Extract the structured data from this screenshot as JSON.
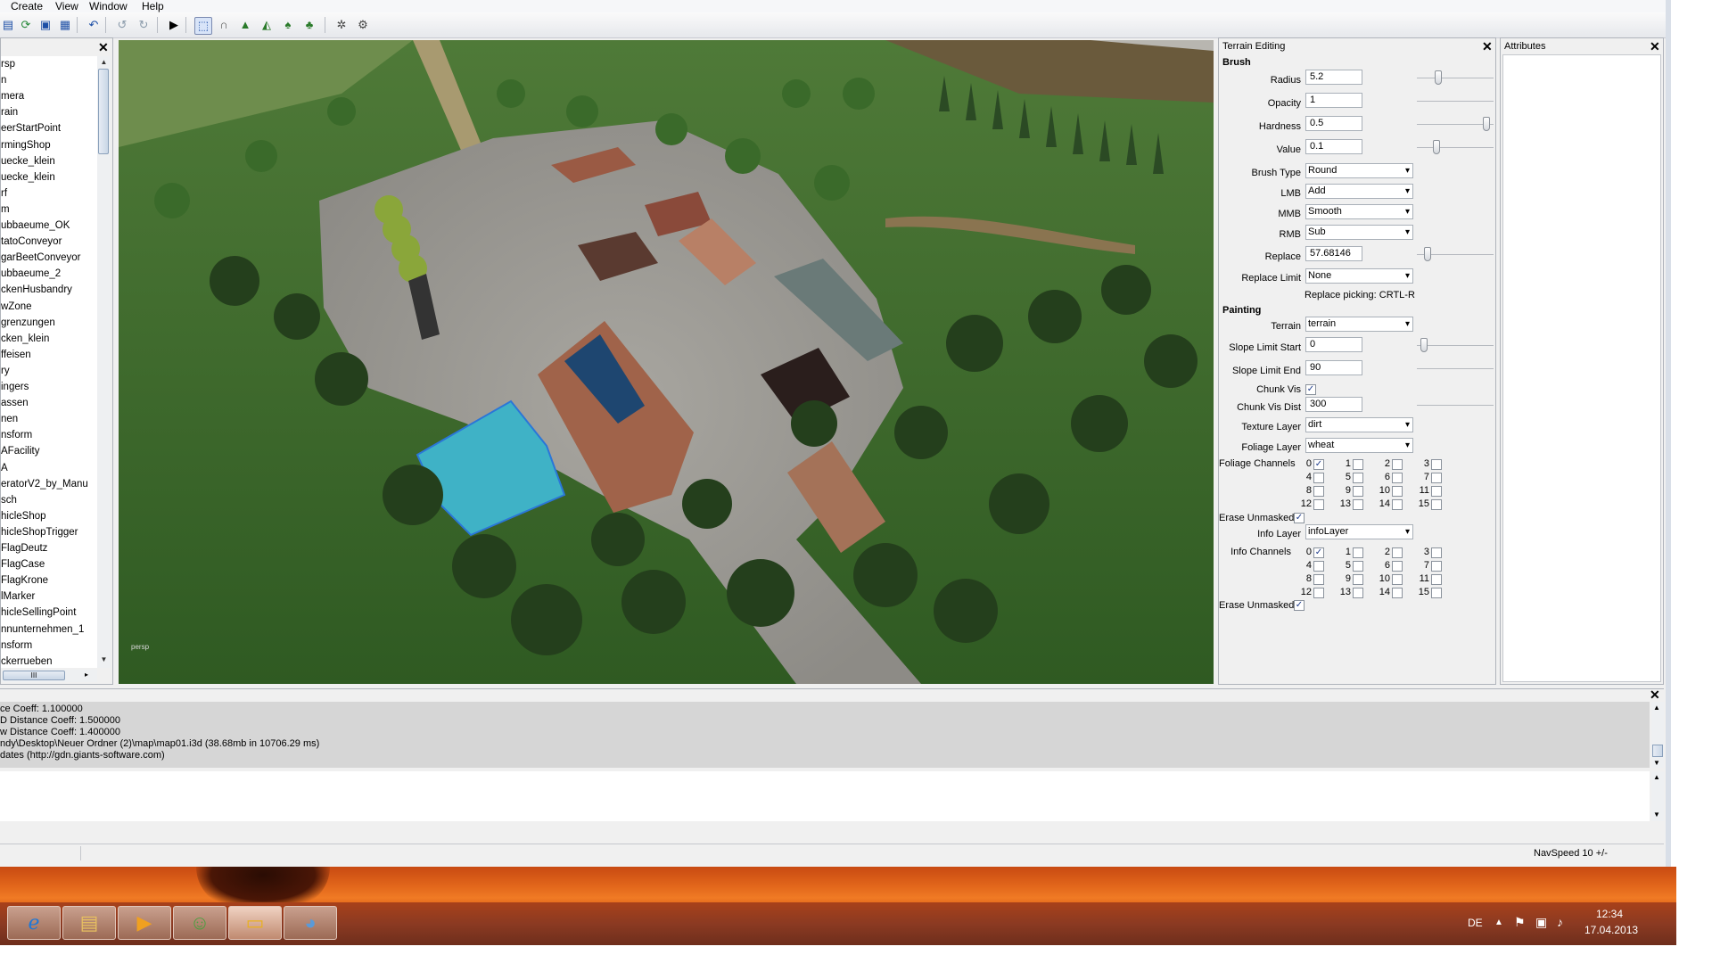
{
  "menu": [
    "Create",
    "View",
    "Window",
    "Help"
  ],
  "toolbar_icons": [
    "new-icon",
    "open-icon",
    "save-icon",
    "save-all-icon",
    "import-icon",
    "undo-icon",
    "redo-icon",
    "play-icon",
    "select-mode-icon",
    "move-mode-icon",
    "terrain-sculpt-icon",
    "terrain-paint-icon",
    "foliage-paint-icon",
    "info-paint-icon",
    "settings-icon",
    "settings-alt-icon"
  ],
  "scene_tree": {
    "items": [
      "rsp",
      "n",
      "mera",
      "rain",
      "eerStartPoint",
      "rmingShop",
      "uecke_klein",
      "uecke_klein",
      "rf",
      "m",
      "ubbaeume_OK",
      "tatoConveyor",
      "garBeetConveyor",
      "ubbaeume_2",
      "ckenHusbandry",
      "wZone",
      "grenzungen",
      "cken_klein",
      "ffeisen",
      "ry",
      "ingers",
      "assen",
      "nen",
      "nsform",
      "AFacility",
      "A",
      "eratorV2_by_Manu",
      "sch",
      "hicleShop",
      "hicleShopTrigger",
      "FlagDeutz",
      "FlagCase",
      "FlagKrone",
      "lMarker",
      "hicleSellingPoint",
      "nnunternehmen_1",
      "nsform",
      "ckerrueben"
    ],
    "hscroll_label": "III"
  },
  "viewport": {
    "label": "persp"
  },
  "terrain_editing": {
    "title": "Terrain Editing",
    "brush_section": "Brush",
    "radius_label": "Radius",
    "radius_value": "5.2",
    "radius_level": 0.25,
    "opacity_label": "Opacity",
    "opacity_value": "1",
    "hardness_label": "Hardness",
    "hardness_value": "0.5",
    "hardness_level": 0.95,
    "value_label": "Value",
    "value_value": "0.1",
    "value_level": 0.23,
    "brush_type_label": "Brush Type",
    "brush_type_value": "Round",
    "lmb_label": "LMB",
    "lmb_value": "Add",
    "mmb_label": "MMB",
    "mmb_value": "Smooth",
    "rmb_label": "RMB",
    "rmb_value": "Sub",
    "replace_label": "Replace",
    "replace_value": "57.68146",
    "replace_level": 0.1,
    "replace_limit_label": "Replace Limit",
    "replace_limit_value": "None",
    "replace_picking_note": "Replace picking: CRTL-R",
    "painting_section": "Painting",
    "terrain_label": "Terrain",
    "terrain_value": "terrain",
    "slope_start_label": "Slope Limit Start",
    "slope_start_value": "0",
    "slope_start_level": 0.05,
    "slope_end_label": "Slope Limit End",
    "slope_end_value": "90",
    "chunk_vis_label": "Chunk Vis",
    "chunk_vis_checked": true,
    "chunk_vis_dist_label": "Chunk Vis Dist",
    "chunk_vis_dist_value": "300",
    "texture_layer_label": "Texture Layer",
    "texture_layer_value": "dirt",
    "foliage_layer_label": "Foliage Layer",
    "foliage_layer_value": "wheat",
    "foliage_channels_label": "Foliage Channels",
    "foliage_channels_checked": [
      0
    ],
    "erase_unmasked_label": "Erase Unmasked",
    "erase_unmasked_1": true,
    "info_layer_label": "Info Layer",
    "info_layer_value": "infoLayer",
    "info_channels_label": "Info Channels",
    "info_channels_checked": [
      0
    ],
    "erase_unmasked_2": true,
    "channels": [
      "0",
      "1",
      "2",
      "3",
      "4",
      "5",
      "6",
      "7",
      "8",
      "9",
      "10",
      "11",
      "12",
      "13",
      "14",
      "15"
    ]
  },
  "attributes": {
    "title": "Attributes"
  },
  "console": {
    "lines": [
      "ce Coeff: 1.100000",
      "D Distance Coeff: 1.500000",
      "w Distance Coeff: 1.400000",
      "ndy\\Desktop\\Neuer Ordner (2)\\map\\map01.i3d (38.68mb in 10706.29 ms)",
      "dates (http://gdn.giants-software.com)"
    ]
  },
  "status": {
    "navspeed": "NavSpeed 10 +/-"
  },
  "taskbar": {
    "apps": [
      "ie-icon",
      "explorer-icon",
      "media-player-icon",
      "users-icon",
      "editor-icon",
      "paint-icon"
    ],
    "lang": "DE",
    "time": "12:34",
    "date": "17.04.2013"
  },
  "colors": {
    "accent": "#1c3a8a",
    "taskbar": "#8b3a22",
    "desktop": "#e0641a"
  }
}
